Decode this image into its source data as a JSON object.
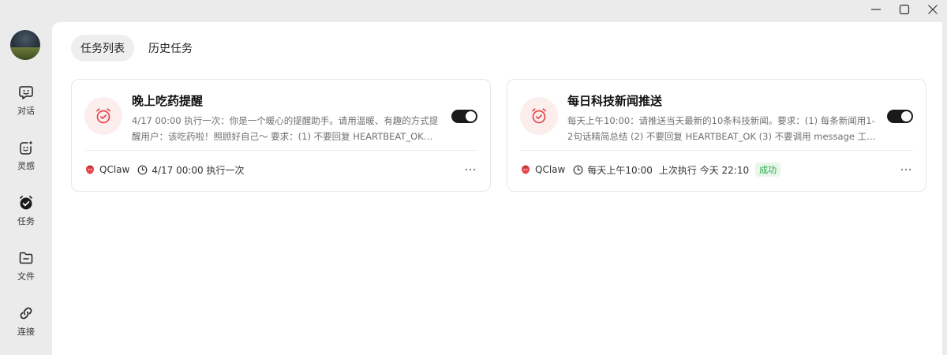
{
  "window": {
    "controls": [
      "minimize",
      "maximize",
      "close"
    ]
  },
  "sidebar": {
    "items": [
      {
        "label": "对话",
        "icon": "chat-smile-icon"
      },
      {
        "label": "灵感",
        "icon": "sparkle-face-icon"
      },
      {
        "label": "任务",
        "icon": "task-check-icon"
      },
      {
        "label": "文件",
        "icon": "folder-icon"
      },
      {
        "label": "连接",
        "icon": "link-icon"
      }
    ]
  },
  "tabs": [
    {
      "label": "任务列表",
      "active": true
    },
    {
      "label": "历史任务",
      "active": false
    }
  ],
  "tasks": [
    {
      "title": "晚上吃药提醒",
      "description": "4/17 00:00 执行一次：你是一个暖心的提醒助手。请用温暖、有趣的方式提醒用户：该吃药啦！照顾好自己～ 要求：(1) 不要回复 HEARTBEAT_OK…",
      "enabled": true,
      "agent": "QClaw",
      "schedule": "4/17 00:00 执行一次",
      "last_run": "",
      "status": ""
    },
    {
      "title": "每日科技新闻推送",
      "description": "每天上午10:00：请推送当天最新的10条科技新闻。要求：(1) 每条新闻用1-2句话精简总结 (2) 不要回复 HEARTBEAT_OK (3) 不要调用 message 工…",
      "enabled": true,
      "agent": "QClaw",
      "schedule": "每天上午10:00",
      "last_run": "上次执行 今天 22:10",
      "status": "成功"
    }
  ],
  "colors": {
    "accent_red": "#e8454a",
    "toggle_on": "#1a1a1a",
    "success": "#28a745",
    "sidebar_bg": "#ebebeb"
  }
}
